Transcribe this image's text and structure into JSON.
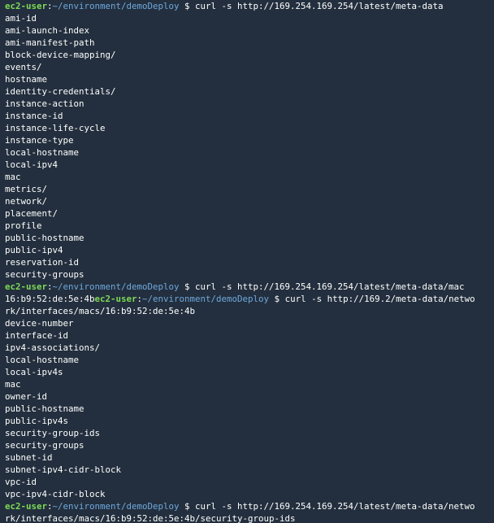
{
  "terminal": {
    "lines": [
      [
        {
          "t": "ec2-user",
          "c": "user"
        },
        {
          "t": ":",
          "c": "plain"
        },
        {
          "t": "~/environment/demoDeploy",
          "c": "path"
        },
        {
          "t": " $ curl -s http://169.254.169.254/latest/meta-data",
          "c": "plain"
        }
      ],
      [
        {
          "t": "ami-id",
          "c": "plain"
        }
      ],
      [
        {
          "t": "ami-launch-index",
          "c": "plain"
        }
      ],
      [
        {
          "t": "ami-manifest-path",
          "c": "plain"
        }
      ],
      [
        {
          "t": "block-device-mapping/",
          "c": "plain"
        }
      ],
      [
        {
          "t": "events/",
          "c": "plain"
        }
      ],
      [
        {
          "t": "hostname",
          "c": "plain"
        }
      ],
      [
        {
          "t": "identity-credentials/",
          "c": "plain"
        }
      ],
      [
        {
          "t": "instance-action",
          "c": "plain"
        }
      ],
      [
        {
          "t": "instance-id",
          "c": "plain"
        }
      ],
      [
        {
          "t": "instance-life-cycle",
          "c": "plain"
        }
      ],
      [
        {
          "t": "instance-type",
          "c": "plain"
        }
      ],
      [
        {
          "t": "local-hostname",
          "c": "plain"
        }
      ],
      [
        {
          "t": "local-ipv4",
          "c": "plain"
        }
      ],
      [
        {
          "t": "mac",
          "c": "plain"
        }
      ],
      [
        {
          "t": "metrics/",
          "c": "plain"
        }
      ],
      [
        {
          "t": "network/",
          "c": "plain"
        }
      ],
      [
        {
          "t": "placement/",
          "c": "plain"
        }
      ],
      [
        {
          "t": "profile",
          "c": "plain"
        }
      ],
      [
        {
          "t": "public-hostname",
          "c": "plain"
        }
      ],
      [
        {
          "t": "public-ipv4",
          "c": "plain"
        }
      ],
      [
        {
          "t": "reservation-id",
          "c": "plain"
        }
      ],
      [
        {
          "t": "security-groups",
          "c": "plain"
        }
      ],
      [
        {
          "t": "ec2-user",
          "c": "user"
        },
        {
          "t": ":",
          "c": "plain"
        },
        {
          "t": "~/environment/demoDeploy",
          "c": "path"
        },
        {
          "t": " $ curl -s http://169.254.169.254/latest/meta-data/mac",
          "c": "plain"
        }
      ],
      [
        {
          "t": "16:b9:52:de:5e:4b",
          "c": "plain"
        },
        {
          "t": "ec2-user",
          "c": "user"
        },
        {
          "t": ":",
          "c": "plain"
        },
        {
          "t": "~/environment/demoDeploy",
          "c": "path"
        },
        {
          "t": " $ curl -s http://169.2/meta-data/netwo",
          "c": "plain"
        }
      ],
      [
        {
          "t": "rk/interfaces/macs/16:b9:52:de:5e:4b",
          "c": "plain"
        }
      ],
      [
        {
          "t": "device-number",
          "c": "plain"
        }
      ],
      [
        {
          "t": "interface-id",
          "c": "plain"
        }
      ],
      [
        {
          "t": "ipv4-associations/",
          "c": "plain"
        }
      ],
      [
        {
          "t": "local-hostname",
          "c": "plain"
        }
      ],
      [
        {
          "t": "local-ipv4s",
          "c": "plain"
        }
      ],
      [
        {
          "t": "mac",
          "c": "plain"
        }
      ],
      [
        {
          "t": "owner-id",
          "c": "plain"
        }
      ],
      [
        {
          "t": "public-hostname",
          "c": "plain"
        }
      ],
      [
        {
          "t": "public-ipv4s",
          "c": "plain"
        }
      ],
      [
        {
          "t": "security-group-ids",
          "c": "plain"
        }
      ],
      [
        {
          "t": "security-groups",
          "c": "plain"
        }
      ],
      [
        {
          "t": "subnet-id",
          "c": "plain"
        }
      ],
      [
        {
          "t": "subnet-ipv4-cidr-block",
          "c": "plain"
        }
      ],
      [
        {
          "t": "vpc-id",
          "c": "plain"
        }
      ],
      [
        {
          "t": "vpc-ipv4-cidr-block",
          "c": "plain"
        }
      ],
      [
        {
          "t": "ec2-user",
          "c": "user"
        },
        {
          "t": ":",
          "c": "plain"
        },
        {
          "t": "~/environment/demoDeploy",
          "c": "path"
        },
        {
          "t": " $ curl -s http://169.254.169.254/latest/meta-data/netwo",
          "c": "plain"
        }
      ],
      [
        {
          "t": "rk/interfaces/macs/16:b9:52:de:5e:4b/security-group-ids",
          "c": "plain"
        }
      ]
    ]
  },
  "colors": {
    "background": "#232f3e",
    "user": "#7ed957",
    "path": "#6fa8dc",
    "text": "#ffffff"
  }
}
